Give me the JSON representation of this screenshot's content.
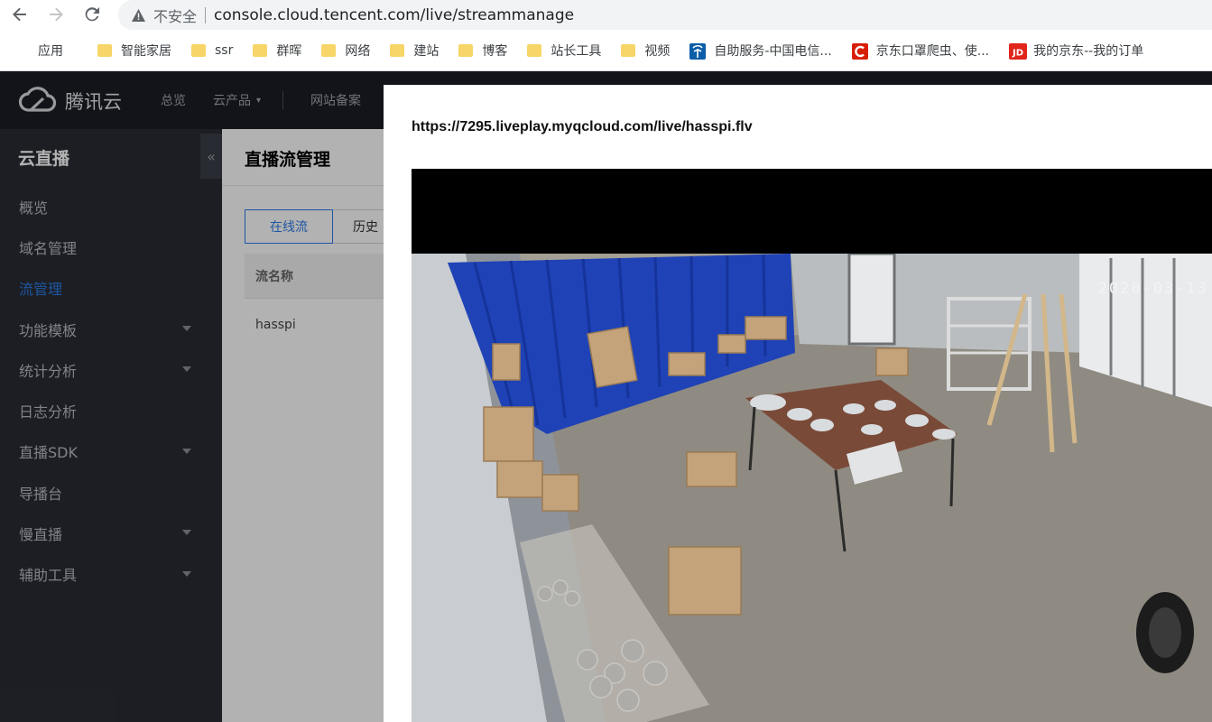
{
  "browser": {
    "insecure_label": "不安全",
    "url": "console.cloud.tencent.com/live/streammanage",
    "bookmarks": [
      {
        "label": "应用",
        "icon": "apps-grid-icon"
      },
      {
        "label": "智能家居",
        "icon": "folder-icon"
      },
      {
        "label": "ssr",
        "icon": "folder-icon"
      },
      {
        "label": "群晖",
        "icon": "folder-icon"
      },
      {
        "label": "网络",
        "icon": "folder-icon"
      },
      {
        "label": "建站",
        "icon": "folder-icon"
      },
      {
        "label": "博客",
        "icon": "folder-icon"
      },
      {
        "label": "站长工具",
        "icon": "folder-icon"
      },
      {
        "label": "视频",
        "icon": "folder-icon"
      },
      {
        "label": "自助服务-中国电信...",
        "icon": "telecom-icon"
      },
      {
        "label": "京东口罩爬虫、使...",
        "icon": "csdn-icon"
      },
      {
        "label": "我的京东--我的订单",
        "icon": "jd-icon"
      }
    ]
  },
  "header": {
    "logo_text": "腾讯云",
    "nav": {
      "overview": "总览",
      "products": "云产品",
      "icp": "网站备案"
    }
  },
  "sidebar": {
    "title": "云直播",
    "items": [
      {
        "label": "概览",
        "active": false,
        "expandable": false
      },
      {
        "label": "域名管理",
        "active": false,
        "expandable": false
      },
      {
        "label": "流管理",
        "active": true,
        "expandable": false
      },
      {
        "label": "功能模板",
        "active": false,
        "expandable": true
      },
      {
        "label": "统计分析",
        "active": false,
        "expandable": true
      },
      {
        "label": "日志分析",
        "active": false,
        "expandable": false
      },
      {
        "label": "直播SDK",
        "active": false,
        "expandable": true
      },
      {
        "label": "导播台",
        "active": false,
        "expandable": false
      },
      {
        "label": "慢直播",
        "active": false,
        "expandable": true
      },
      {
        "label": "辅助工具",
        "active": false,
        "expandable": true
      }
    ]
  },
  "main": {
    "title": "直播流管理",
    "tabs": {
      "online": "在线流",
      "history": "历史"
    },
    "table": {
      "column_stream_name": "流名称",
      "rows": [
        {
          "stream_name": "hasspi"
        }
      ]
    }
  },
  "modal": {
    "play_url": "https://7295.liveplay.myqcloud.com/live/hasspi.flv",
    "timestamp": "2020-03-13"
  },
  "colors": {
    "accent": "#2d7ce8",
    "topbar": "#1a1d26",
    "sidebar": "#292c34"
  }
}
